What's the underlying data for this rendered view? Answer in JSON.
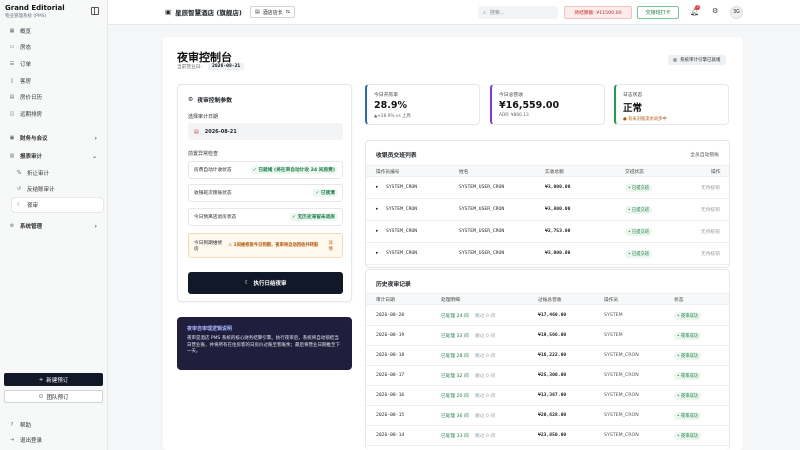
{
  "brand": {
    "name": "Grand Editorial",
    "subtitle": "物业管理系统 (PMS)"
  },
  "sidebar": {
    "items": [
      {
        "label": "概览",
        "icon": "grid-icon"
      },
      {
        "label": "房态",
        "icon": "bed-icon"
      },
      {
        "label": "订单",
        "icon": "list-icon"
      },
      {
        "label": "客房",
        "icon": "door-icon"
      },
      {
        "label": "房价日历",
        "icon": "calendar-icon"
      },
      {
        "label": "远期排房",
        "icon": "layers-icon"
      }
    ],
    "group_finance": "财务与会议",
    "group_audit": "报表审计",
    "audit_items": [
      {
        "label": "折让审计",
        "icon": "percent-icon"
      },
      {
        "label": "反结账审计",
        "icon": "undo-icon"
      },
      {
        "label": "夜审",
        "icon": "moon-icon"
      }
    ],
    "group_system": "系统管理",
    "new_booking": "新建预订",
    "group_booking": "团队预订",
    "help": "帮助",
    "logout": "退出登录"
  },
  "topbar": {
    "hotel_name": "星辰智慧酒店 (旗舰店)",
    "role": "酒店店长",
    "search_placeholder": "搜索...",
    "pending": "待结算额: ¥11500.00",
    "handover": "交接班打卡",
    "notifications": "3",
    "avatar": "3G"
  },
  "page": {
    "title": "夜审控制台",
    "biz_date_label": "当前营业日:",
    "biz_date": "2026-08-21",
    "engine_status": "系统审计引擎已就绪"
  },
  "params": {
    "title": "夜审控制参数",
    "select_label": "选择审计日期",
    "date": "2026-08-21",
    "precheck_label": "前置异常检查",
    "checks": [
      {
        "label": "房费自动计收状态",
        "status": "✓ 已就绪 (将在审自动计收 24 间房费)"
      },
      {
        "label": "收银班次锁账状态",
        "status": "✓ 已锁清"
      },
      {
        "label": "今日预离店退房状态",
        "status": "✓ 无历史滞留未退房"
      },
      {
        "label": "今日到期维修房",
        "status": "⚠ 1间维修房今日到期，夜审将自动回收并转脏",
        "extra": "详情"
      }
    ],
    "run_button": "执行日结夜审"
  },
  "mechanism": {
    "title": "夜审自审理逻辑说明",
    "text": "夜审是酒店 PMS 系统的核心财务结算引擎。执行夜审后，系统将自动锁结当日营业账，并将所有在住房客的日房价过账至客账余；最后将营业日期推至下一天。"
  },
  "stats": [
    {
      "label": "今日开房率",
      "value": "28.9%",
      "sub": "▲+28.9% vs 上周",
      "color": "#2563eb"
    },
    {
      "label": "今日总营收",
      "value": "¥16,559.00",
      "sub": "ADR: ¥860.13",
      "color": "#7c3aed"
    },
    {
      "label": "日志状态",
      "value": "正常",
      "sub": "● 有未对账流水同步中",
      "color": "#16a34a"
    }
  ],
  "shift_table": {
    "title": "收银员交班列表",
    "right_label": "全员自动锁账",
    "headers": [
      "操作员编号",
      "姓名",
      "实收总额",
      "交班状态",
      "操作"
    ],
    "rows": [
      {
        "id": "SYSTEM_CRON",
        "name": "SYSTEM_USER_CRON",
        "amount": "¥3,000.00",
        "status": "已提交班",
        "action": "无待核销"
      },
      {
        "id": "SYSTEM_CRON",
        "name": "SYSTEM_USER_CRON",
        "amount": "¥3,800.00",
        "status": "已提交班",
        "action": "无待核销"
      },
      {
        "id": "SYSTEM_CRON",
        "name": "SYSTEM_USER_CRON",
        "amount": "¥2,753.00",
        "status": "已提交班",
        "action": "无待核销"
      },
      {
        "id": "SYSTEM_CRON",
        "name": "SYSTEM_USER_CRON",
        "amount": "¥3,000.00",
        "status": "已提交班",
        "action": "无待核销"
      }
    ]
  },
  "history": {
    "title": "历史夜审记录",
    "headers": [
      "审计日期",
      "处理明细",
      "过账总营收",
      "操作员",
      "状态"
    ],
    "rows": [
      {
        "date": "2026-08-20",
        "done": "已处理 24 间",
        "skip": "跳过 0 间",
        "revenue": "¥17,460.00",
        "op": "SYSTEM",
        "status": "夜审成功"
      },
      {
        "date": "2026-08-19",
        "done": "已处理 33 间",
        "skip": "跳过 0 间",
        "revenue": "¥19,566.00",
        "op": "SYSTEM",
        "status": "夜审成功"
      },
      {
        "date": "2026-08-18",
        "done": "已处理 28 间",
        "skip": "跳过 0 间",
        "revenue": "¥16,222.00",
        "op": "SYSTEM_CRON",
        "status": "夜审成功"
      },
      {
        "date": "2026-08-17",
        "done": "已处理 32 间",
        "skip": "跳过 0 间",
        "revenue": "¥25,300.00",
        "op": "SYSTEM_CRON",
        "status": "夜审成功"
      },
      {
        "date": "2026-08-16",
        "done": "已处理 20 间",
        "skip": "跳过 0 间",
        "revenue": "¥13,387.00",
        "op": "SYSTEM_CRON",
        "status": "夜审成功"
      },
      {
        "date": "2026-08-15",
        "done": "已处理 36 间",
        "skip": "跳过 0 间",
        "revenue": "¥20,628.00",
        "op": "SYSTEM_CRON",
        "status": "夜审成功"
      },
      {
        "date": "2026-08-14",
        "done": "已处理 33 间",
        "skip": "跳过 0 间",
        "revenue": "¥23,850.00",
        "op": "SYSTEM_CRON",
        "status": "夜审成功"
      }
    ]
  }
}
